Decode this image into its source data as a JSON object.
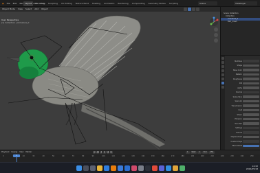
{
  "menu": [
    "Blender",
    "File",
    "Edit",
    "Render",
    "Window",
    "Help"
  ],
  "workspaces": [
    "Layout",
    "Modeling",
    "Sculpting",
    "UV Editing",
    "Texture Paint",
    "Shading",
    "Animation",
    "Rendering",
    "Compositing",
    "Geometry Nodes",
    "Scripting"
  ],
  "active_workspace": "Layout",
  "scene": "Scene",
  "view_layer": "ViewLayer",
  "viewport": {
    "header": [
      "Object Mode",
      "View",
      "Select",
      "Add",
      "Object"
    ],
    "info_title": "User Perspective",
    "info_sub": "(1) Collection | Armature_0",
    "colors": {
      "background": "#3d3d3d",
      "bird_head": "#1f9a4a",
      "bird_body": "#8a8a84"
    }
  },
  "outliner": {
    "rows": [
      "Scene Collection",
      "Collection",
      "Armature_0",
      "Bird_mesh"
    ],
    "selected": 2
  },
  "properties": {
    "rows": [
      {
        "label": "Modifiers",
        "style": "dark"
      },
      {
        "label": "Shape",
        "style": ""
      },
      {
        "label": "Base Color",
        "style": ""
      },
      {
        "label": "Metallic",
        "style": ""
      },
      {
        "label": "Roughness",
        "style": ""
      },
      {
        "label": "IOR",
        "style": ""
      },
      {
        "label": "Alpha",
        "style": ""
      },
      {
        "label": "Normal",
        "style": "dark"
      },
      {
        "label": "Subsurface",
        "style": ""
      },
      {
        "label": "Specular",
        "style": ""
      },
      {
        "label": "Transmission",
        "style": ""
      },
      {
        "label": "Coat",
        "style": ""
      },
      {
        "label": "Sheen",
        "style": ""
      },
      {
        "label": "Emission",
        "style": ""
      },
      {
        "label": "Thin Film",
        "style": ""
      },
      {
        "label": "Settings",
        "style": "dark"
      },
      {
        "label": "Volume",
        "style": "dark"
      },
      {
        "label": "Displacement",
        "style": ""
      },
      {
        "label": "Custom Props",
        "style": "dark"
      },
      {
        "label": "Blend Mode",
        "style": "blue"
      }
    ]
  },
  "timeline": {
    "menu": [
      "Playback",
      "Keying",
      "View",
      "Marker"
    ],
    "current_frame": "1",
    "start_label": "Start",
    "start": "1",
    "end_label": "End",
    "end": "250",
    "ticks": [
      "0",
      "10",
      "20",
      "30",
      "40",
      "50",
      "60",
      "70",
      "80",
      "90",
      "100",
      "110",
      "120",
      "130",
      "140",
      "150",
      "160",
      "170",
      "180",
      "190",
      "200",
      "210",
      "220",
      "230",
      "240",
      "250"
    ],
    "controls": [
      "|◀",
      "◀◀",
      "◀",
      "▶",
      "▶▶",
      "▶|"
    ]
  },
  "taskbar": {
    "time": "14:32",
    "date": "2024/05/18",
    "apps": [
      {
        "name": "windows-logo",
        "color": "#3a8ee6"
      },
      {
        "name": "search",
        "color": "#4a4f5c"
      },
      {
        "name": "task-view",
        "color": "#5b6070"
      },
      {
        "name": "explorer",
        "color": "#e8b53a"
      },
      {
        "name": "browser",
        "color": "#2e7de0"
      },
      {
        "name": "blender",
        "color": "#e87d0d"
      },
      {
        "name": "store",
        "color": "#3b7bd9"
      },
      {
        "name": "mail",
        "color": "#2b6fd1"
      },
      {
        "name": "photos",
        "color": "#d04a6b"
      },
      {
        "name": "settings",
        "color": "#7a7f8a"
      },
      {
        "name": "terminal",
        "color": "#2b2f38"
      },
      {
        "name": "music",
        "color": "#e04a3a"
      },
      {
        "name": "chat",
        "color": "#5a63d6"
      },
      {
        "name": "code",
        "color": "#2f8fe0"
      },
      {
        "name": "files",
        "color": "#e0a43a"
      },
      {
        "name": "misc",
        "color": "#4fb06a"
      }
    ]
  }
}
